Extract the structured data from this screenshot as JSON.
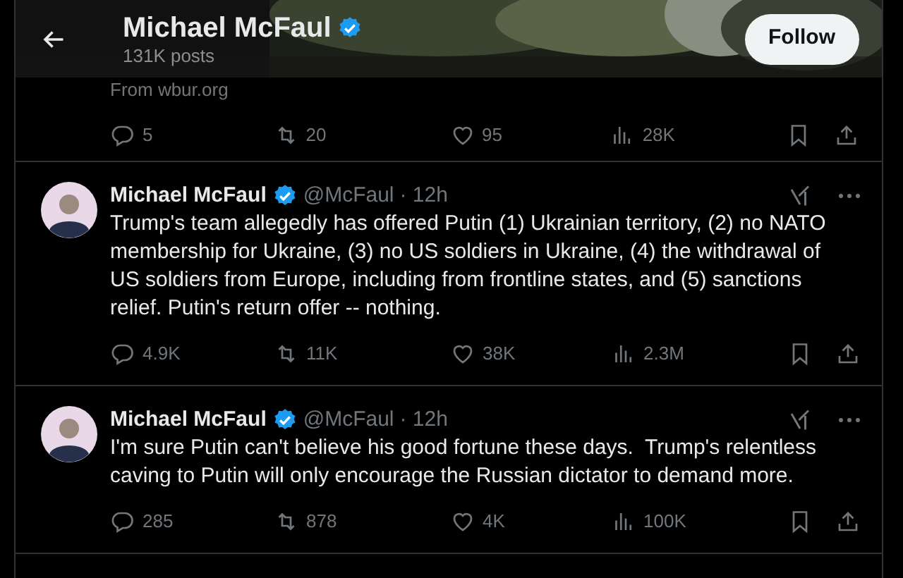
{
  "header": {
    "title": "Michael McFaul",
    "verified": true,
    "subtitle": "131K posts",
    "follow_button": "Follow"
  },
  "previous_post": {
    "source": "From wbur.org",
    "stats": {
      "replies": "5",
      "reposts": "20",
      "likes": "95",
      "views": "28K"
    }
  },
  "posts": [
    {
      "name": "Michael McFaul",
      "verified": true,
      "handle": "@McFaul",
      "time": "· 12h",
      "text": "Trump's team allegedly has offered Putin (1) Ukrainian territory, (2) no NATO membership for Ukraine, (3) no US soldiers in Ukraine, (4) the withdrawal of US soldiers from Europe, including from frontline states, and (5) sanctions relief. Putin's return offer -- nothing.",
      "stats": {
        "replies": "4.9K",
        "reposts": "11K",
        "likes": "38K",
        "views": "2.3M"
      }
    },
    {
      "name": "Michael McFaul",
      "verified": true,
      "handle": "@McFaul",
      "time": "· 12h",
      "text": "I'm sure Putin can't believe his good fortune these days.  Trump's relentless caving to Putin will only encourage the Russian dictator to demand more.",
      "stats": {
        "replies": "285",
        "reposts": "878",
        "likes": "4K",
        "views": "100K"
      }
    }
  ]
}
